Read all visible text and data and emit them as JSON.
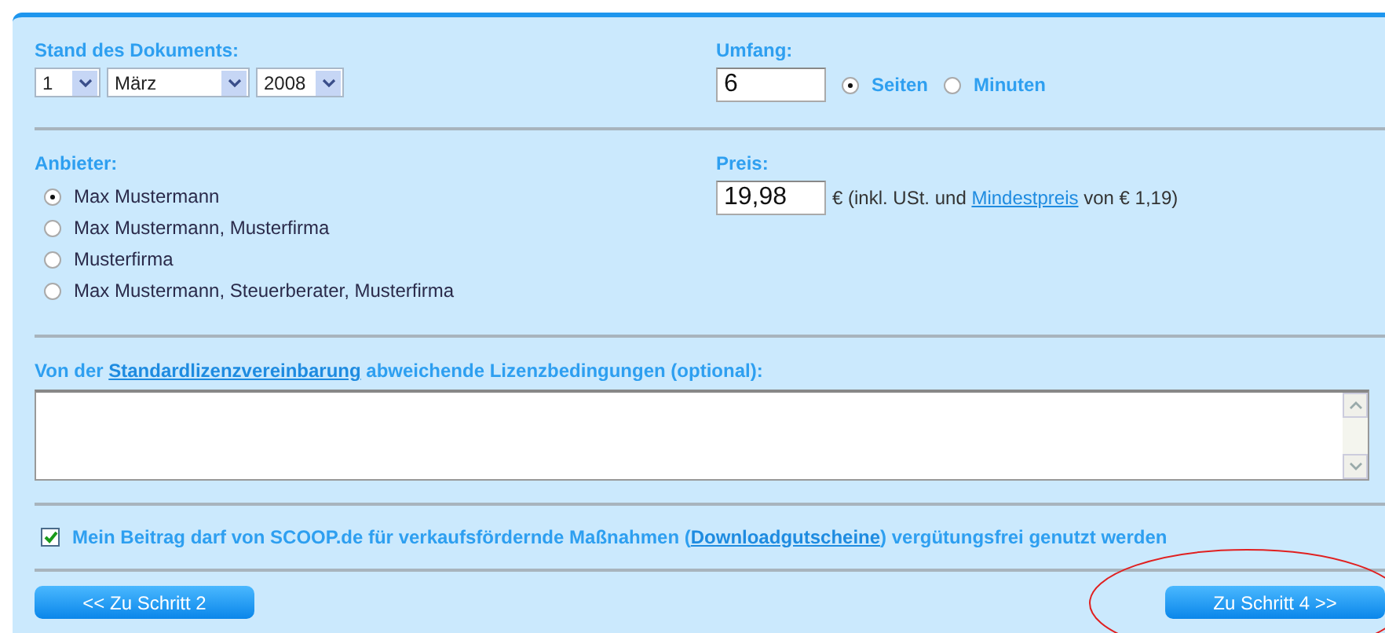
{
  "date": {
    "label": "Stand des Dokuments:",
    "day": "1",
    "month": "März",
    "year": "2008"
  },
  "umfang": {
    "label": "Umfang:",
    "value": "6",
    "units": [
      {
        "label": "Seiten",
        "selected": true
      },
      {
        "label": "Minuten",
        "selected": false
      }
    ]
  },
  "anbieter": {
    "label": "Anbieter:",
    "options": [
      {
        "label": "Max Mustermann",
        "selected": true
      },
      {
        "label": "Max Mustermann, Musterfirma",
        "selected": false
      },
      {
        "label": "Musterfirma",
        "selected": false
      },
      {
        "label": "Max Mustermann, Steuerberater, Musterfirma",
        "selected": false
      }
    ]
  },
  "preis": {
    "label": "Preis:",
    "value": "19,98",
    "note_before": "€ (inkl. USt. und ",
    "note_link": "Mindestpreis",
    "note_after": " von € 1,19)"
  },
  "license": {
    "label_before": "Von der ",
    "label_link": "Standardlizenzvereinbarung",
    "label_after": " abweichende Lizenzbedingungen (optional):"
  },
  "consent": {
    "checked": true,
    "text_before": "Mein Beitrag darf von SCOOP.de für verkaufsfördernde Maßnahmen (",
    "text_link": "Downloadgutscheine",
    "text_after": ") vergütungsfrei genutzt werden"
  },
  "buttons": [
    {
      "label": "<< Zu Schritt 2"
    },
    {
      "label": "Zu Schritt 4 >>"
    }
  ],
  "annotation": {
    "kind": "ellipse"
  }
}
